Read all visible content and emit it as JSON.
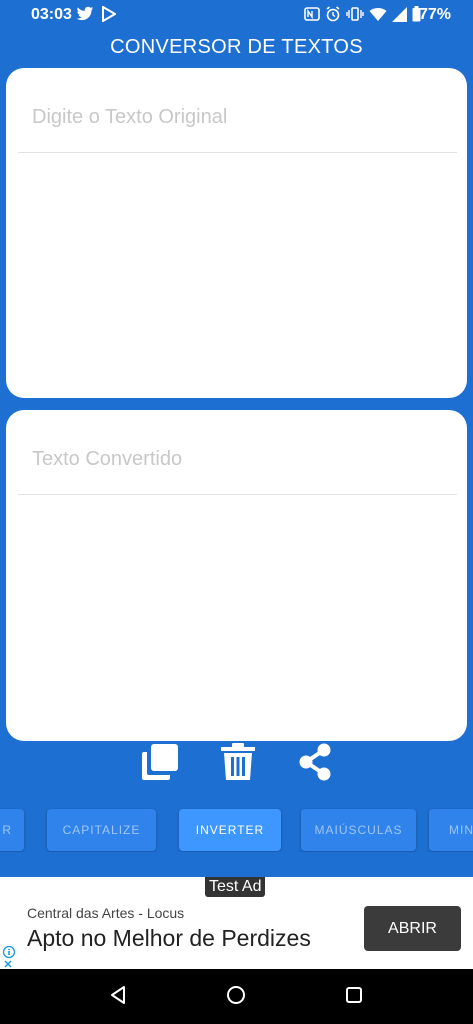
{
  "status_bar": {
    "time": "03:03",
    "battery_percent": "77%",
    "left_icons": [
      "twitter-icon",
      "play-store-icon"
    ],
    "right_icons": [
      "nfc-icon",
      "alarm-icon",
      "vibrate-icon",
      "wifi-icon",
      "signal-icon",
      "battery-icon"
    ]
  },
  "app_bar": {
    "title": "CONVERSOR DE TEXTOS"
  },
  "input_card": {
    "placeholder": "Digite o Texto Original",
    "value": ""
  },
  "output_card": {
    "placeholder": "Texto Convertido",
    "value": ""
  },
  "actions": {
    "copy_icon": "copy-icon",
    "delete_icon": "trash-icon",
    "share_icon": "share-icon"
  },
  "modes": {
    "items": [
      {
        "label": "R"
      },
      {
        "label": "CAPITALIZE"
      },
      {
        "label": "INVERTER",
        "active": true
      },
      {
        "label": "MAIÚSCULAS"
      },
      {
        "label": "MIN"
      }
    ]
  },
  "ad": {
    "badge": "Test Ad",
    "advertiser": "Central das Artes - Locus",
    "headline": "Apto no Melhor de Perdizes",
    "cta": "ABRIR"
  },
  "colors": {
    "background": "#1e6fd2",
    "button": "#2f83ea",
    "button_active": "#3d97ff",
    "card": "#ffffff"
  }
}
